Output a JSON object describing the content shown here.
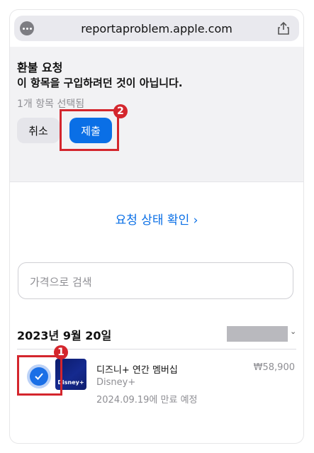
{
  "browser": {
    "url": "reportaproblem.apple.com",
    "menu_icon": "more-icon",
    "share_icon": "share-icon"
  },
  "refund": {
    "title": "환불 요청",
    "reason": "이 항목을 구입하려던 것이 아닙니다.",
    "selected_count": "1개 항목 선택됨",
    "cancel_label": "취소",
    "submit_label": "제출"
  },
  "status_link": "요청 상태 확인 ›",
  "search": {
    "placeholder": "가격으로 검색"
  },
  "purchase": {
    "date": "2023년 9월 20일",
    "item": {
      "name": "디즈니+ 연간 멤버십",
      "publisher": "Disney+",
      "expires": "2024.09.19에 만료 예정",
      "price": "₩58,900",
      "thumb_text": "Disney+",
      "checked": true
    }
  },
  "annotations": [
    {
      "number": "1",
      "target": "item-checkbox"
    },
    {
      "number": "2",
      "target": "submit-button"
    }
  ],
  "colors": {
    "accent": "#0a6fe6",
    "annotation": "#d4262d"
  }
}
